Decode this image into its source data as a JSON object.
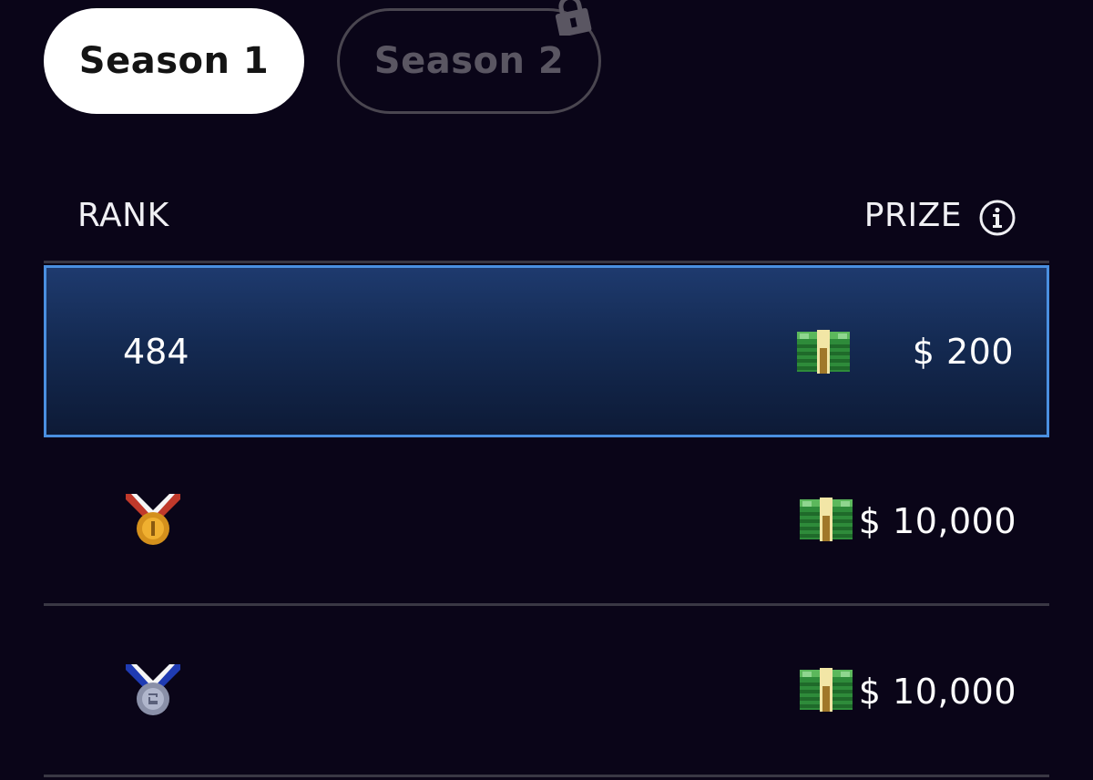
{
  "tabs": [
    {
      "label": "Season 1",
      "active": true,
      "locked": false
    },
    {
      "label": "Season 2",
      "active": false,
      "locked": true
    }
  ],
  "table": {
    "rank_header": "RANK",
    "prize_header": "PRIZE",
    "rows": [
      {
        "rank": "484",
        "rank_icon": null,
        "prize_icon": "money-stack-icon",
        "prize": "$ 200",
        "highlighted": true
      },
      {
        "rank": "",
        "rank_icon": "gold-medal-icon",
        "prize_icon": "money-stack-icon",
        "prize": "$ 10,000",
        "highlighted": false
      },
      {
        "rank": "",
        "rank_icon": "silver-medal-icon",
        "prize_icon": "money-stack-icon",
        "prize": "$ 10,000",
        "highlighted": false
      }
    ]
  },
  "colors": {
    "background": "#0a0518",
    "highlight_border": "#4a8fe0",
    "highlight_fill": "#1e3a6e",
    "divider": "#3a3844"
  }
}
